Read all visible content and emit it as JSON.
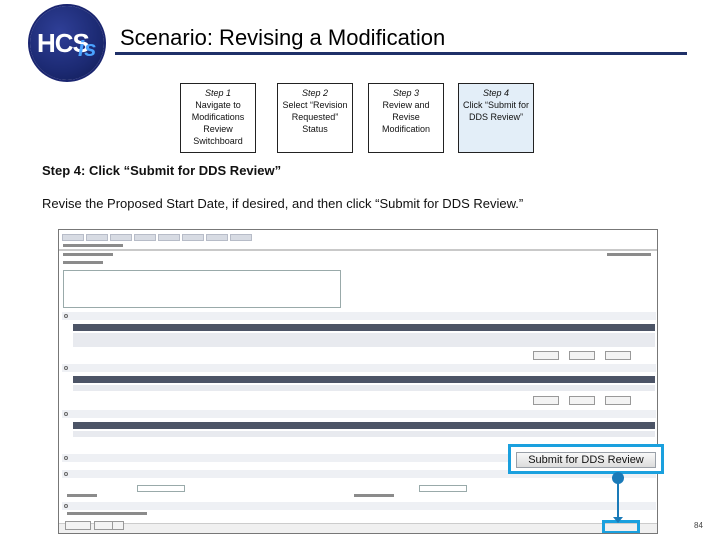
{
  "logo": {
    "text": "HCS",
    "suffix": "is"
  },
  "title": "Scenario: Revising a Modification",
  "steps": [
    {
      "title": "Step 1",
      "desc": "Navigate to Modifications Review Switchboard"
    },
    {
      "title": "Step 2",
      "desc": "Select “Revision Requested” Status"
    },
    {
      "title": "Step 3",
      "desc": "Review and Revise Modification"
    },
    {
      "title": "Step 4",
      "desc": "Click “Submit for DDS Review”"
    }
  ],
  "step4_heading": "Step 4: Click “Submit for DDS Review”",
  "instruction": "Revise the Proposed Start Date, if desired, and then click “Submit for DDS Review.”",
  "callout_button": "Submit for DDS Review",
  "page_number": "84",
  "colors": {
    "accent": "#1aa0de",
    "title_rule": "#1f3068",
    "active_step": "#e3eef8"
  }
}
